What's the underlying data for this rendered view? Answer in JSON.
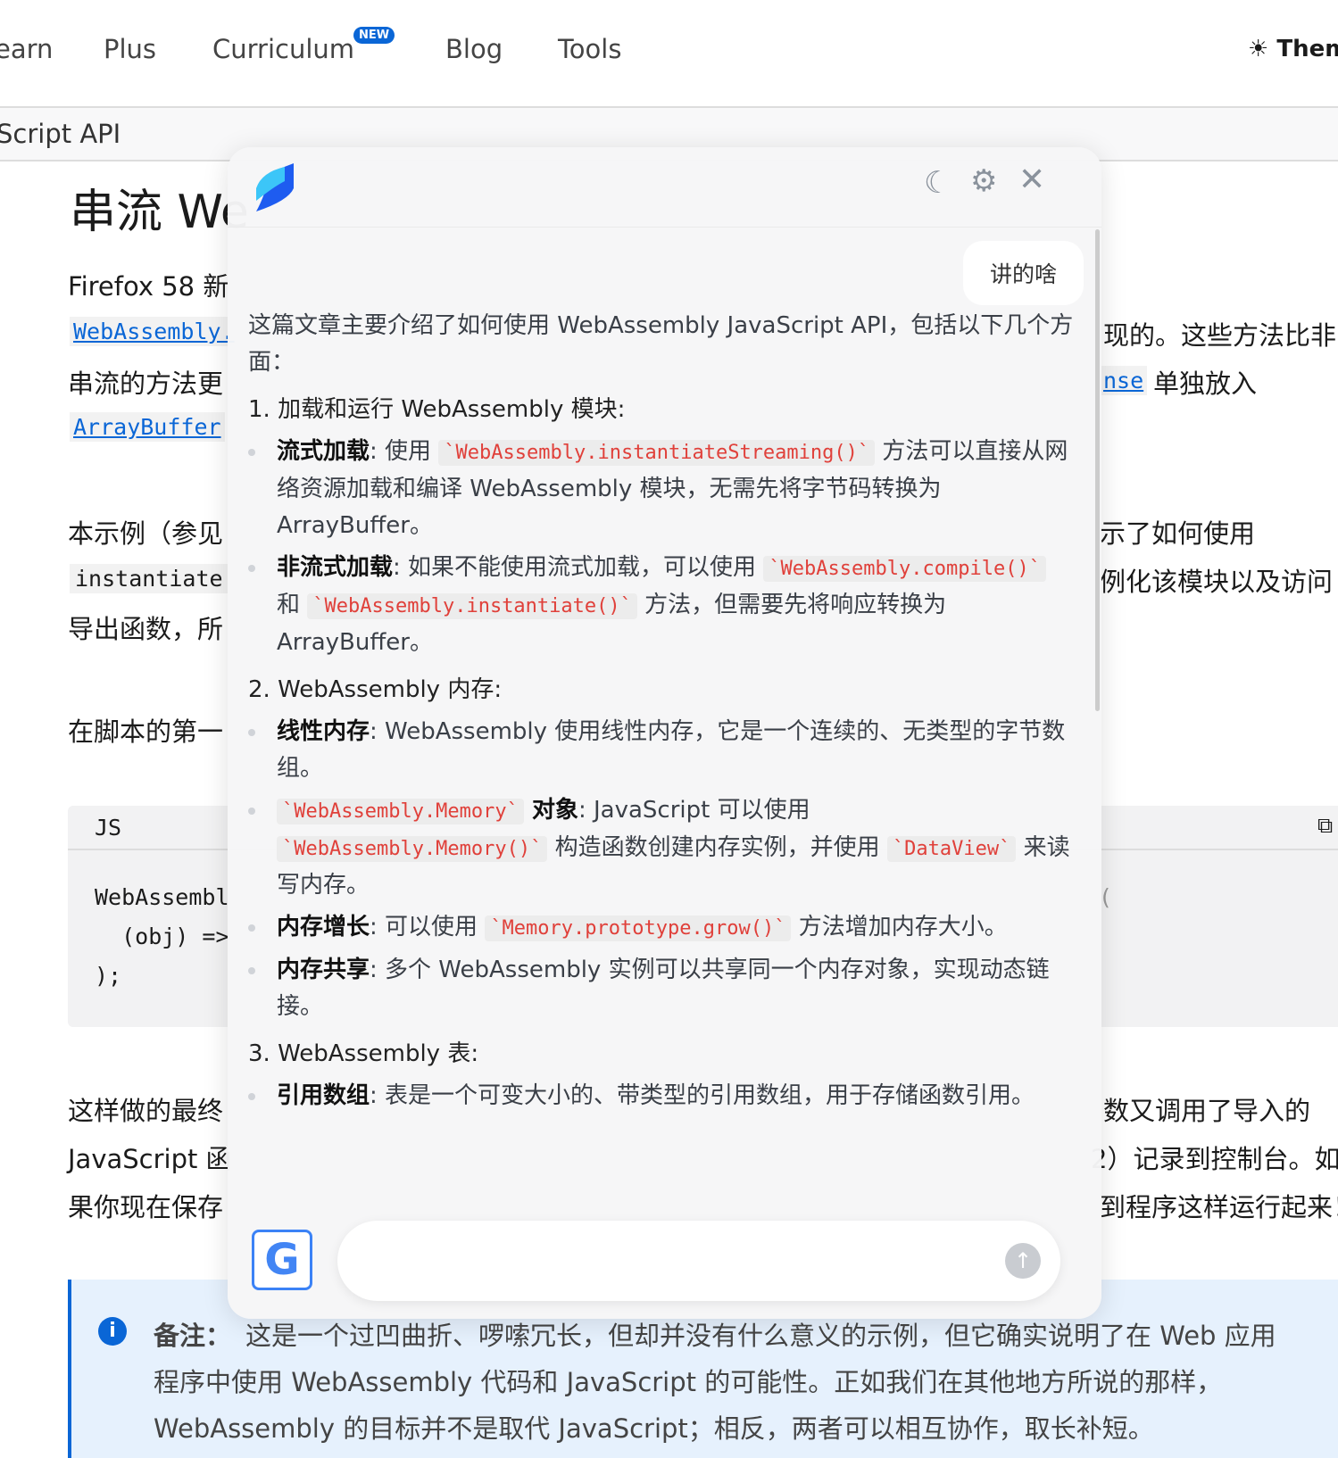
{
  "nav": {
    "items": [
      "earn",
      "Plus",
      "Curriculum",
      "Blog",
      "Tools"
    ],
    "badge": "NEW",
    "theme": "Them"
  },
  "breadcrumb": "Script API",
  "page": {
    "title": "串流 We",
    "p1": "Firefox 58 新",
    "link1": "WebAssembly.",
    "p1b": "串流的方法更",
    "link2": "ArrayBuffer",
    "r1": "现的。这些方法比非",
    "r2link": "nse",
    "r2": "单独放入",
    "p2": "本示例（参见",
    "p2code": "instantiate",
    "p2b": "导出函数，所",
    "r3": "示了如何使用",
    "r4": "例化该模块以及访问",
    "p3": "在脚本的第一",
    "code_lang": "JS",
    "code": [
      "WebAssembl",
      "  (obj) =>",
      ");"
    ],
    "code_r": "(",
    "p4": [
      "这样做的最终",
      "JavaScript 函",
      "果你现在保存"
    ],
    "r5": [
      "数又调用了导入的",
      "2）记录到控制台。如",
      "到程序这样运行起来！"
    ],
    "note_label": "备注：",
    "note": [
      "这是一个过凹曲折、啰嗦冗长，但却并没有什么意义的示例，但它确实说明了在 Web 应用",
      "程序中使用 WebAssembly 代码和 JavaScript 的可能性。正如我们在其他地方所说的那样，",
      "WebAssembly 的目标并不是取代 JavaScript；相反，两者可以相互协作，取长补短。"
    ]
  },
  "panel": {
    "user_message": "讲的啥",
    "intro": "这篇文章主要介绍了如何使用 WebAssembly JavaScript API，包括以下几个方面：",
    "s1": "1. 加载和运行 WebAssembly 模块:",
    "s1a_b": "流式加载",
    "s1a_1": ": 使用 ",
    "s1a_c": "`WebAssembly.instantiateStreaming()`",
    "s1a_2": " 方法可以直接从网络资源加载和编译 WebAssembly 模块，无需先将字节码转换为 ArrayBuffer。",
    "s1b_b": "非流式加载",
    "s1b_1": ": 如果不能使用流式加载，可以使用 ",
    "s1b_c1": "`WebAssembly.compile()`",
    "s1b_2": " 和 ",
    "s1b_c2": "`WebAssembly.instantiate()`",
    "s1b_3": " 方法，但需要先将响应转换为 ArrayBuffer。",
    "s2": "2. WebAssembly 内存:",
    "s2a_b": "线性内存",
    "s2a": ": WebAssembly 使用线性内存，它是一个连续的、无类型的字节数组。",
    "s2b_c1": "`WebAssembly.Memory`",
    "s2b_b": " 对象",
    "s2b_1": ": JavaScript 可以使用 ",
    "s2b_c2": "`WebAssembly.Memory()`",
    "s2b_2": " 构造函数创建内存实例，并使用 ",
    "s2b_c3": "`DataView`",
    "s2b_3": " 来读写内存。",
    "s2c_b": "内存增长",
    "s2c_1": ": 可以使用 ",
    "s2c_c": "`Memory.prototype.grow()`",
    "s2c_2": " 方法增加内存大小。",
    "s2d_b": "内存共享",
    "s2d": ": 多个 WebAssembly 实例可以共享同一个内存对象，实现动态链接。",
    "s3": "3. WebAssembly 表:",
    "s3a_b": "引用数组",
    "s3a": ": 表是一个可变大小的、带类型的引用数组，用于存储函数引用。",
    "google_letter": "G"
  }
}
